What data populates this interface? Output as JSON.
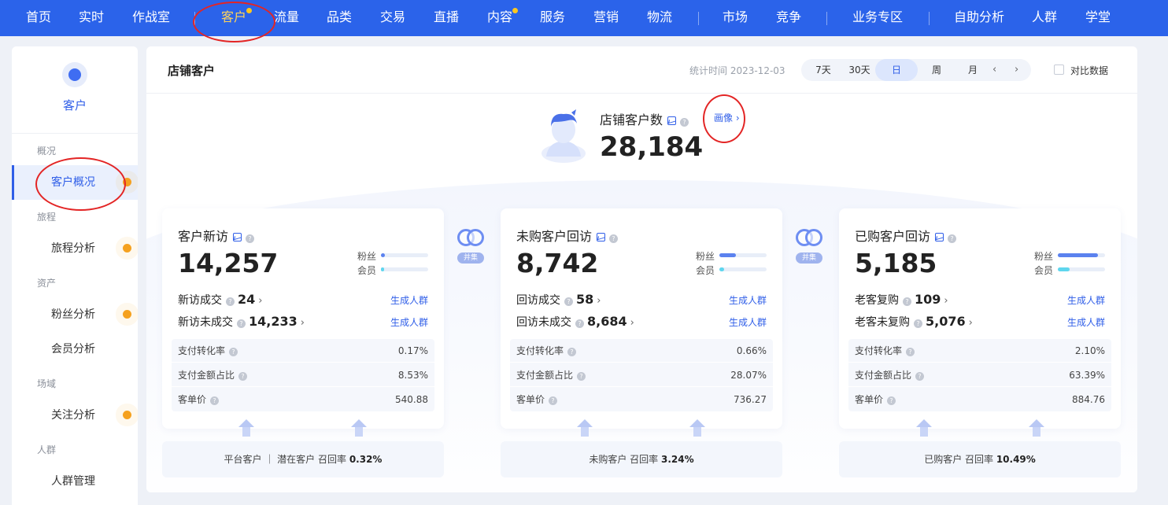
{
  "topnav": {
    "items": [
      {
        "label": "首页",
        "dot": false,
        "active": false
      },
      {
        "label": "实时",
        "dot": false,
        "active": false
      },
      {
        "label": "作战室",
        "dot": false,
        "active": false
      },
      {
        "label": "客户",
        "dot": true,
        "active": true
      },
      {
        "label": "流量",
        "dot": false,
        "active": false
      },
      {
        "label": "品类",
        "dot": false,
        "active": false
      },
      {
        "label": "交易",
        "dot": false,
        "active": false
      },
      {
        "label": "直播",
        "dot": false,
        "active": false
      },
      {
        "label": "内容",
        "dot": true,
        "active": false
      },
      {
        "label": "服务",
        "dot": false,
        "active": false
      },
      {
        "label": "营销",
        "dot": false,
        "active": false
      },
      {
        "label": "物流",
        "dot": false,
        "active": false
      },
      {
        "label": "市场",
        "dot": false,
        "active": false
      },
      {
        "label": "竞争",
        "dot": false,
        "active": false
      },
      {
        "label": "业务专区",
        "dot": false,
        "active": false
      },
      {
        "label": "自助分析",
        "dot": false,
        "active": false
      },
      {
        "label": "人群",
        "dot": false,
        "active": false
      },
      {
        "label": "学堂",
        "dot": false,
        "active": false
      }
    ]
  },
  "sidebar": {
    "title": "客户",
    "groups": [
      {
        "label": "概况"
      },
      {
        "label": "旅程"
      },
      {
        "label": "资产"
      },
      {
        "label": "场域"
      },
      {
        "label": "人群"
      }
    ],
    "items": [
      {
        "label": "客户概况",
        "active": true,
        "badge": true
      },
      {
        "label": "旅程分析",
        "active": false,
        "badge": true
      },
      {
        "label": "粉丝分析",
        "active": false,
        "badge": true
      },
      {
        "label": "会员分析",
        "active": false,
        "badge": false
      },
      {
        "label": "关注分析",
        "active": false,
        "badge": true
      },
      {
        "label": "人群管理",
        "active": false,
        "badge": false
      }
    ]
  },
  "header": {
    "title": "店铺客户",
    "stat_time": "统计时间 2023-12-03",
    "ranges": [
      "7天",
      "30天",
      "日",
      "周",
      "月"
    ],
    "active_range": "日",
    "prev": "‹",
    "next": "›",
    "compare_label": "对比数据"
  },
  "total": {
    "label": "店铺客户数",
    "value": "28,184",
    "portrait_link": "画像 ›"
  },
  "common": {
    "fans_label": "粉丝",
    "member_label": "会员",
    "gen_crowd": "生成人群",
    "union_tag": "并集",
    "q": "?"
  },
  "cards": [
    {
      "title": "客户新访",
      "value": "14,257",
      "fans_level": 0.08,
      "member_level": 0.06,
      "sub1_label": "新访成交",
      "sub1_value": "24",
      "sub2_label": "新访未成交",
      "sub2_value": "14,233",
      "metrics": [
        {
          "label": "支付转化率",
          "value": "0.17%"
        },
        {
          "label": "支付金额占比",
          "value": "8.53%"
        },
        {
          "label": "客单价",
          "value": "540.88"
        }
      ],
      "footer": {
        "text": "平台客户 ｜ 潜在客户  召回率 ",
        "bold": "0.32%"
      }
    },
    {
      "title": "未购客户回访",
      "value": "8,742",
      "fans_level": 0.35,
      "member_level": 0.1,
      "sub1_label": "回访成交",
      "sub1_value": "58",
      "sub2_label": "回访未成交",
      "sub2_value": "8,684",
      "metrics": [
        {
          "label": "支付转化率",
          "value": "0.66%"
        },
        {
          "label": "支付金额占比",
          "value": "28.07%"
        },
        {
          "label": "客单价",
          "value": "736.27"
        }
      ],
      "footer": {
        "text": "未购客户  召回率 ",
        "bold": "3.24%"
      }
    },
    {
      "title": "已购客户回访",
      "value": "5,185",
      "fans_level": 0.85,
      "member_level": 0.25,
      "sub1_label": "老客复购",
      "sub1_value": "109",
      "sub2_label": "老客未复购",
      "sub2_value": "5,076",
      "metrics": [
        {
          "label": "支付转化率",
          "value": "2.10%"
        },
        {
          "label": "支付金额占比",
          "value": "63.39%"
        },
        {
          "label": "客单价",
          "value": "884.76"
        }
      ],
      "footer": {
        "text": "已购客户  召回率 ",
        "bold": "10.49%"
      }
    }
  ],
  "colors": {
    "brand": "#2b63ea",
    "accent": "#2f5ee8",
    "nav_active": "#ffd45a",
    "badge_orange": "#f5a11f",
    "fans_bar": "#5b82ef",
    "member_bar": "#5fd6ee",
    "annotation_red": "#e32525"
  }
}
